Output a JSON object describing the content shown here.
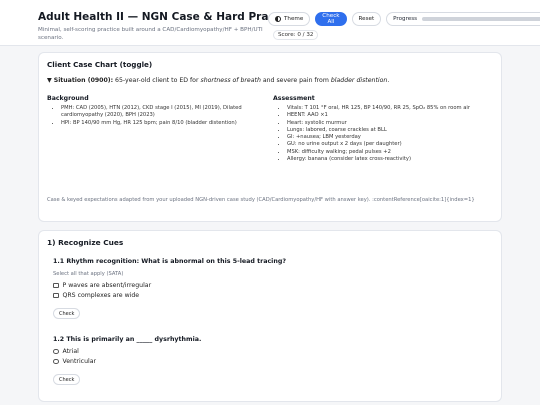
{
  "header": {
    "title": "Adult Health II — NGN Case & Hard Practice",
    "subtitle": "Minimal, self-scoring practice built around a CAD/Cardiomyopathy/HF + BPH/UTI scenario.",
    "theme_label": "Theme",
    "check_all_label": "Check All",
    "reset_label": "Reset",
    "progress_label": "Progress",
    "progress_fraction": 0.0,
    "score_text": "Score: 0 / 32"
  },
  "case_chart": {
    "title": "Client Case Chart (toggle)",
    "situation_label": "Situation (0900):",
    "situation_text": " 65-year-old client to ED for ",
    "situation_em1": "shortness of breath",
    "situation_mid": " and severe pain from ",
    "situation_em2": "bladder distention",
    "situation_end": ".",
    "background_heading": "Background",
    "background_items": [
      "PMH: CAD (2005), HTN (2012), CKD stage I (2015), MI (2019), Dilated cardiomyopathy (2020), BPH (2023)",
      "HPI: BP 140/90 mm Hg, HR 125 bpm; pain 8/10 (bladder distention)"
    ],
    "assessment_heading": "Assessment",
    "assessment_items": [
      "Vitals: T 101 °F oral, HR 125, BP 140/90, RR 25, SpO₂ 85% on room air",
      "HEENT: AAO ×1",
      "Heart: systolic murmur",
      "Lungs: labored, coarse crackles at BLL",
      "GI: +nausea; LBM yesterday",
      "GU: no urine output x 2 days (per daughter)",
      "MSK: difficulty walking; pedal pulses +2",
      "Allergy: banana (consider latex cross-reactivity)"
    ],
    "source_note": "Case & keyed expectations adapted from your uploaded NGN-driven case study (CAD/Cardiomyopathy/HF with answer key). :contentReference[oaicite:1]{index=1}"
  },
  "recognize": {
    "title": "1) Recognize Cues",
    "q1": {
      "title": "1.1 Rhythm recognition: What is abnormal on this 5-lead tracing?",
      "note": "Select all that apply (SATA)",
      "options": [
        "P waves are absent/irregular",
        "QRS complexes are wide"
      ],
      "check_label": "Check"
    },
    "q2": {
      "title": "1.2 This is primarily an _____ dysrhythmia.",
      "options": [
        "Atrial",
        "Ventricular"
      ],
      "check_label": "Check"
    }
  }
}
